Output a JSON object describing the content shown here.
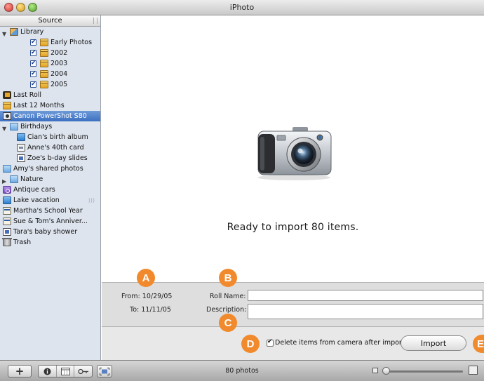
{
  "window": {
    "title": "iPhoto"
  },
  "sidebar": {
    "header": "Source",
    "items": [
      {
        "label": "Library",
        "icon": "library-icon",
        "indent": 0,
        "disclosure": "open",
        "checked": false,
        "selected": false
      },
      {
        "label": "Early Photos",
        "icon": "calendar-icon",
        "indent": 1,
        "disclosure": "",
        "checked": true,
        "selected": false
      },
      {
        "label": "2002",
        "icon": "calendar-icon",
        "indent": 1,
        "disclosure": "",
        "checked": true,
        "selected": false
      },
      {
        "label": "2003",
        "icon": "calendar-icon",
        "indent": 1,
        "disclosure": "",
        "checked": true,
        "selected": false
      },
      {
        "label": "2004",
        "icon": "calendar-icon",
        "indent": 1,
        "disclosure": "",
        "checked": true,
        "selected": false
      },
      {
        "label": "2005",
        "icon": "calendar-icon",
        "indent": 1,
        "disclosure": "",
        "checked": true,
        "selected": false
      },
      {
        "label": "Last Roll",
        "icon": "film-roll-icon",
        "indent": 0,
        "disclosure": "",
        "checked": false,
        "selected": false
      },
      {
        "label": "Last 12 Months",
        "icon": "calendar-icon",
        "indent": 0,
        "disclosure": "",
        "checked": false,
        "selected": false
      },
      {
        "label": "Canon PowerShot S80",
        "icon": "camera-icon",
        "indent": 0,
        "disclosure": "",
        "checked": false,
        "selected": true
      },
      {
        "label": "Birthdays",
        "icon": "folder-icon",
        "indent": 0,
        "disclosure": "open",
        "checked": false,
        "selected": false
      },
      {
        "label": "Cian's birth album",
        "icon": "album-icon",
        "indent": 1,
        "disclosure": "",
        "checked": false,
        "selected": false
      },
      {
        "label": "Anne's 40th card",
        "icon": "card-icon",
        "indent": 1,
        "disclosure": "",
        "checked": false,
        "selected": false
      },
      {
        "label": "Zoe's b-day slides",
        "icon": "slideshow-icon",
        "indent": 1,
        "disclosure": "",
        "checked": false,
        "selected": false
      },
      {
        "label": "Amy's shared photos",
        "icon": "shared-folder-icon",
        "indent": 0,
        "disclosure": "",
        "checked": false,
        "selected": false
      },
      {
        "label": "Nature",
        "icon": "folder-icon",
        "indent": 0,
        "disclosure": "closed",
        "checked": false,
        "selected": false
      },
      {
        "label": "Antique cars",
        "icon": "smart-album-icon",
        "indent": 0,
        "disclosure": "",
        "checked": false,
        "selected": false
      },
      {
        "label": "Lake vacation",
        "icon": "album-icon",
        "indent": 0,
        "disclosure": "",
        "checked": false,
        "selected": false,
        "shared": true
      },
      {
        "label": "Martha's School Year",
        "icon": "calendar-book-icon",
        "indent": 0,
        "disclosure": "",
        "checked": false,
        "selected": false
      },
      {
        "label": "Sue & Tom's Anniver...",
        "icon": "book-icon",
        "indent": 0,
        "disclosure": "",
        "checked": false,
        "selected": false
      },
      {
        "label": "Tara's baby shower",
        "icon": "slideshow-icon",
        "indent": 0,
        "disclosure": "",
        "checked": false,
        "selected": false
      },
      {
        "label": "Trash",
        "icon": "trash-icon",
        "indent": 0,
        "disclosure": "",
        "checked": false,
        "selected": false
      }
    ]
  },
  "main": {
    "status": "Ready to import 80 items.",
    "camera_icon": "digital-camera-icon"
  },
  "import": {
    "from_label": "From:",
    "from_value": "10/29/05",
    "to_label": "To:",
    "to_value": "11/11/05",
    "roll_name_label": "Roll Name:",
    "roll_name_value": "",
    "description_label": "Description:",
    "description_value": "",
    "delete_label": "Delete items from camera after importing",
    "delete_checked": true,
    "import_button": "Import"
  },
  "callouts": [
    "A",
    "B",
    "C",
    "D",
    "E"
  ],
  "toolbar": {
    "photo_count": "80 photos",
    "add_icon": "plus-icon",
    "info_icon": "info-icon",
    "calendar_icon": "calendar-icon",
    "keyword_icon": "key-icon",
    "fullscreen_icon": "fullscreen-icon",
    "zoom_level": 0.0
  },
  "colors": {
    "selection": "#3c6fc0",
    "callout": "#f18a2c",
    "sidebar_bg": "#dde4ee"
  }
}
